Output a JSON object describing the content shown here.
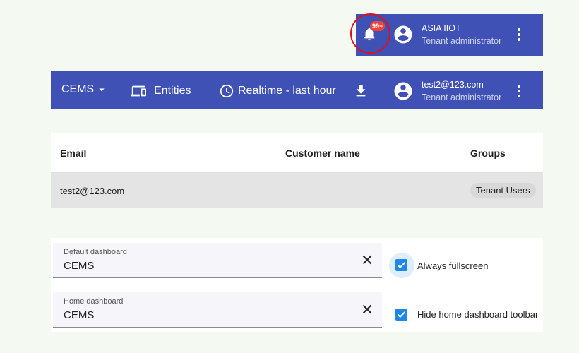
{
  "top_header": {
    "notifications_badge": "99+",
    "user_name": "ASIA IIOT",
    "user_role": "Tenant administrator"
  },
  "dashboard_toolbar": {
    "dashboard_select": "CEMS",
    "entities_label": "Entities",
    "timewindow_label": "Realtime - last hour",
    "user_name": "test2@123.com",
    "user_role": "Tenant administrator"
  },
  "users_table": {
    "columns": [
      "Email",
      "Customer name",
      "Groups"
    ],
    "rows": [
      {
        "email": "test2@123.com",
        "customer_name": "",
        "group": "Tenant Users"
      }
    ]
  },
  "settings": {
    "default_dashboard": {
      "label": "Default dashboard",
      "value": "CEMS"
    },
    "home_dashboard": {
      "label": "Home dashboard",
      "value": "CEMS"
    },
    "always_fullscreen": {
      "label": "Always fullscreen",
      "checked": true
    },
    "hide_toolbar": {
      "label": "Hide home dashboard toolbar",
      "checked": true
    }
  },
  "colors": {
    "primary": "#3f51b5",
    "badge": "#f44336",
    "highlight_ring": "#e0101a",
    "checkbox": "#1e88e5"
  }
}
